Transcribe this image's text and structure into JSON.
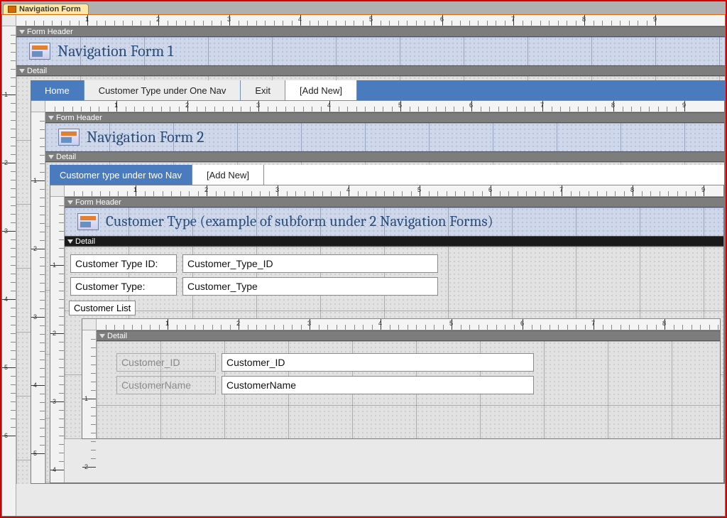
{
  "docTab": {
    "label": "Navigation Form"
  },
  "outer": {
    "sections": {
      "header": "Form Header",
      "detail": "Detail"
    },
    "title": "Navigation Form 1",
    "tabs": [
      {
        "label": "Home",
        "state": "active"
      },
      {
        "label": "Customer Type under One Nav",
        "state": "normal"
      },
      {
        "label": "Exit",
        "state": "normal"
      },
      {
        "label": "[Add New]",
        "state": "addnew"
      }
    ]
  },
  "mid": {
    "sections": {
      "header": "Form Header",
      "detail": "Detail"
    },
    "title": "Navigation Form 2",
    "tabs": [
      {
        "label": "Customer type under two Nav",
        "state": "active"
      },
      {
        "label": "[Add New]",
        "state": "addnew"
      }
    ]
  },
  "inner": {
    "sections": {
      "header": "Form Header",
      "detail": "Detail"
    },
    "title": "Customer Type (example of subform under 2 Navigation Forms)",
    "fields": [
      {
        "label": "Customer Type ID:",
        "value": "Customer_Type_ID"
      },
      {
        "label": "Customer Type:",
        "value": "Customer_Type"
      }
    ],
    "sublist_label": "Customer List"
  },
  "deep": {
    "sections": {
      "detail": "Detail"
    },
    "fields": [
      {
        "label": "Customer_ID",
        "value": "Customer_ID"
      },
      {
        "label": "CustomerName",
        "value": "CustomerName"
      }
    ]
  },
  "ruler": {
    "labels": [
      "1",
      "2",
      "3",
      "4",
      "5",
      "6",
      "7",
      "8",
      "9"
    ]
  }
}
